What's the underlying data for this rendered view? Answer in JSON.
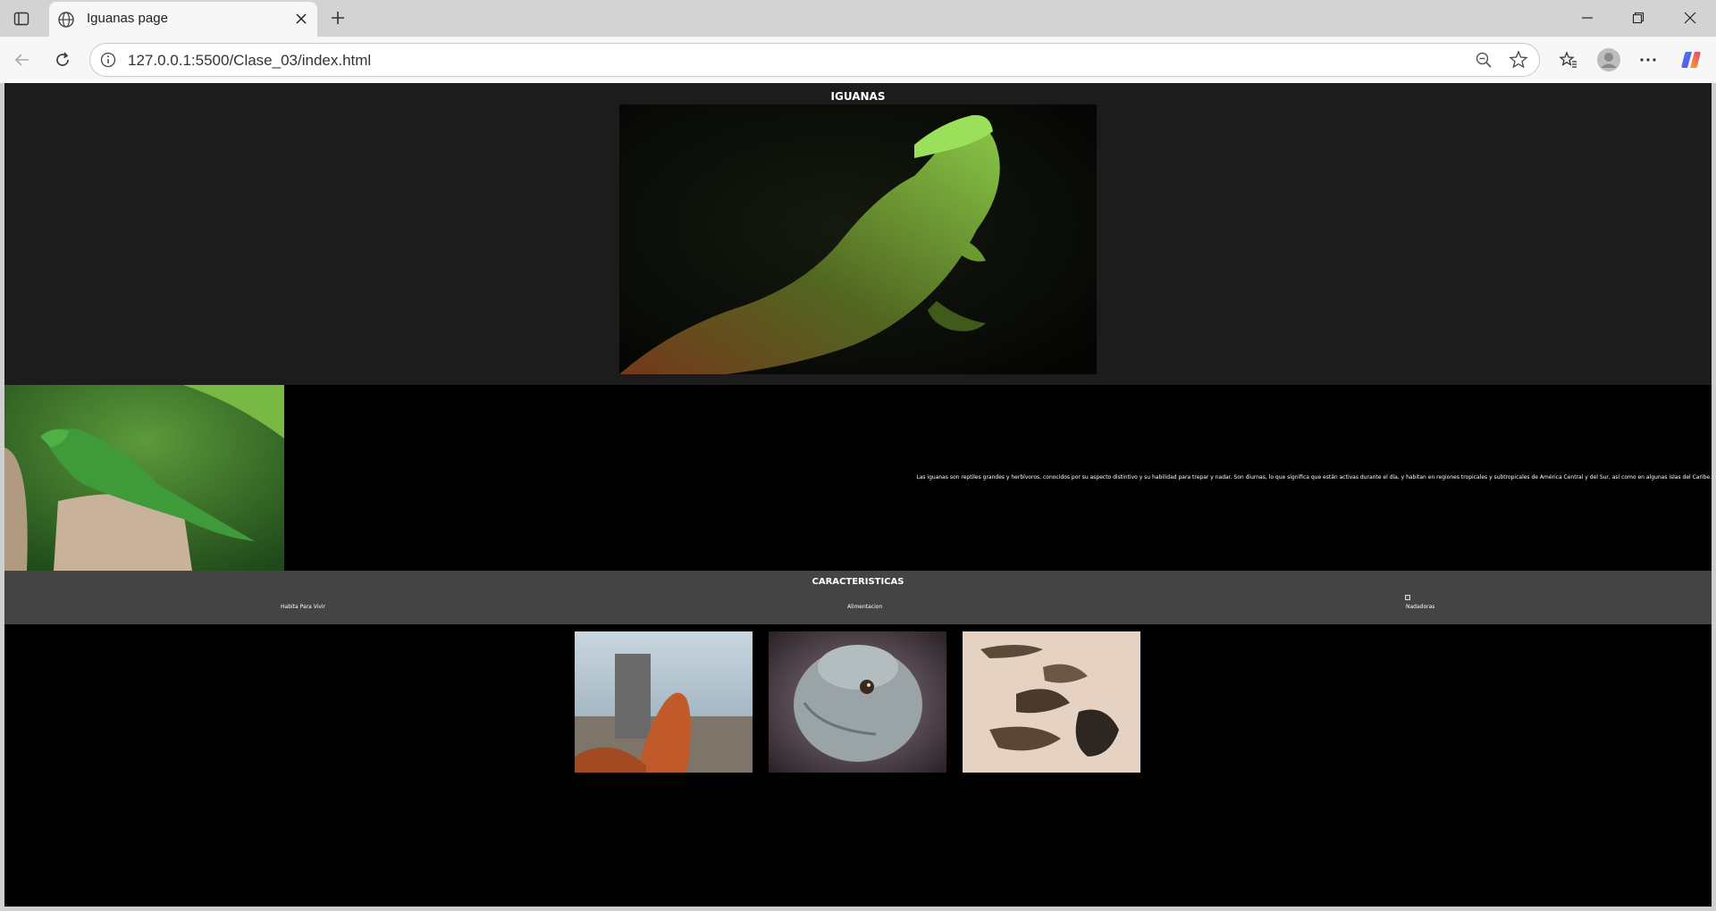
{
  "browser": {
    "tab_title": "Iguanas page",
    "url": "127.0.0.1:5500/Clase_03/index.html",
    "icons": [
      "tab-actions-icon",
      "globe-icon",
      "close-icon",
      "plus-icon",
      "minimize-icon",
      "restore-icon",
      "back-icon",
      "refresh-icon",
      "info-icon",
      "zoom-out-icon",
      "star-icon",
      "favorites-icon",
      "profile-icon",
      "more-icon",
      "copilot-icon"
    ]
  },
  "page": {
    "hero_title": "IGUANAS",
    "intro_text": "Las iguanas son reptiles grandes y herbívoros, conocidos por su aspecto distintivo y su habilidad para trepar y nadar. Son diurnas, lo que significa que están activas durante el día, y habitan en regiones tropicales y subtropicales de América Central y del Sur, así como en algunas islas del Caribe.",
    "features_title": "CARACTERISTICAS",
    "features": [
      {
        "label": "Habita Para Vivir"
      },
      {
        "label": "Alimentacion"
      },
      {
        "label": "Nadadoras"
      }
    ],
    "colors": {
      "hero_bg": "#1c1c1c",
      "features_bg": "#444444",
      "page_bg": "#000000"
    }
  }
}
